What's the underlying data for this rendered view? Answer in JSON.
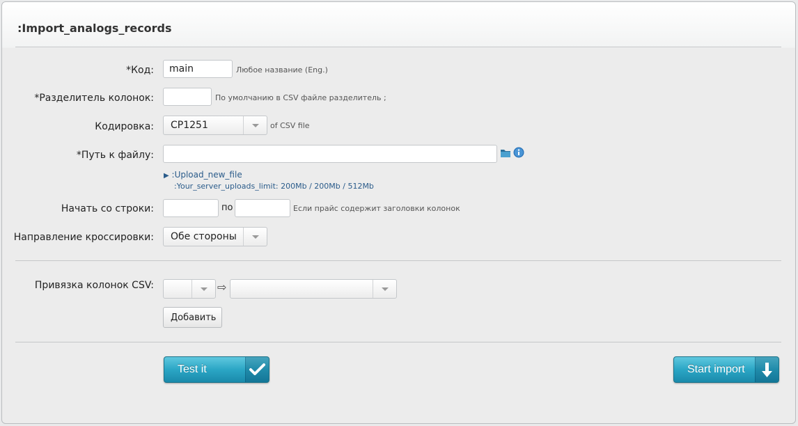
{
  "title": ":Import_analogs_records",
  "fields": {
    "code": {
      "label": "*Код:",
      "value": "main",
      "hint": "Любое название (Eng.)"
    },
    "separator": {
      "label": "*Разделитель колонок:",
      "value": "",
      "hint": "По умолчанию в CSV файле разделитель ;"
    },
    "encoding": {
      "label": "Кодировка:",
      "value": "CP1251",
      "hint": "of CSV file"
    },
    "file_path": {
      "label": "*Путь к файлу:",
      "value": "",
      "upload_link": ":Upload_new_file",
      "limit_label": ":Your_server_uploads_limit:",
      "limit_value": "200Mb / 200Mb / 512Mb"
    },
    "start_row": {
      "label": "Начать со строки:",
      "from_value": "",
      "to_label": "по",
      "to_value": "",
      "hint": "Если прайс содержит заголовки колонок"
    },
    "direction": {
      "label": "Направление кроссировки:",
      "value": "Обе стороны"
    },
    "column_binding": {
      "label": "Привязка колонок CSV:",
      "left_value": "",
      "right_value": "",
      "add_button": "Добавить"
    }
  },
  "actions": {
    "test_label": "Test it",
    "start_label": "Start import"
  },
  "colors": {
    "primary_button": "#2ba6c5",
    "link": "#2a5b8a"
  }
}
